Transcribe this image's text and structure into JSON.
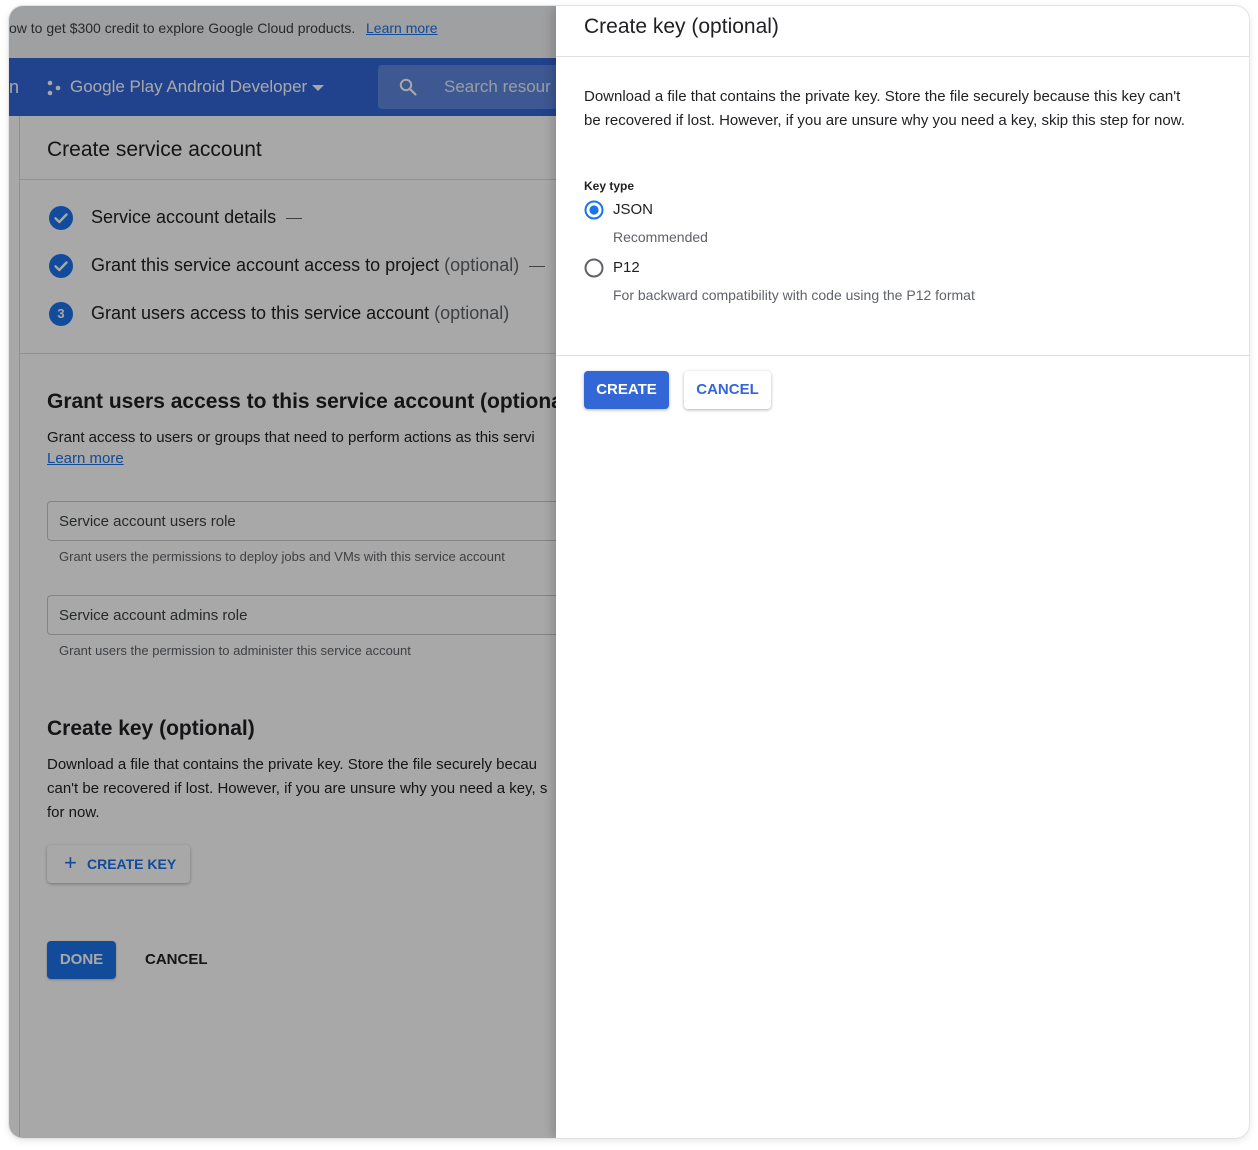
{
  "promo": {
    "text": "ow to get $300 credit to explore Google Cloud products.",
    "link": "Learn more"
  },
  "topbar": {
    "nav_glyph": "n",
    "project_name": "Google Play Android Developer",
    "search_placeholder": "Search resour"
  },
  "page": {
    "title": "Create service account",
    "steps": [
      {
        "label": "Service account details",
        "optional": ""
      },
      {
        "label": "Grant this service account access to project",
        "optional": "(optional)"
      },
      {
        "number": "3",
        "label": "Grant users access to this service account",
        "optional": "(optional)"
      }
    ],
    "grant_section": {
      "title": "Grant users access to this service account (optional)",
      "description": "Grant access to users or groups that need to perform actions as this servi",
      "learn_more": "Learn more",
      "users_role": {
        "label": "Service account users role",
        "hint": "Grant users the permissions to deploy jobs and VMs with this service account"
      },
      "admins_role": {
        "label": "Service account admins role",
        "hint": "Grant users the permission to administer this service account"
      }
    },
    "key_section": {
      "title": "Create key (optional)",
      "line1": "Download a file that contains the private key. Store the file securely becau",
      "line2": "can't be recovered if lost. However, if you are unsure why you need a key, s",
      "line3": "for now.",
      "create_key_button": "CREATE KEY"
    },
    "done_button": "DONE",
    "cancel_button": "CANCEL"
  },
  "panel": {
    "title": "Create key (optional)",
    "description": "Download a file that contains the private key. Store the file securely because this key can't be recovered if lost. However, if you are unsure why you need a key, skip this step for now.",
    "key_type_label": "Key type",
    "options": [
      {
        "label": "JSON",
        "sublabel": "Recommended",
        "selected": true
      },
      {
        "label": "P12",
        "sublabel": "For backward compatibility with code using the P12 format",
        "selected": false
      }
    ],
    "create_button": "CREATE",
    "cancel_button": "CANCEL"
  },
  "colors": {
    "brand_blue": "#3367d6",
    "accent_blue": "#1a73e8",
    "scrim": "rgba(0,0,0,0.34)"
  }
}
